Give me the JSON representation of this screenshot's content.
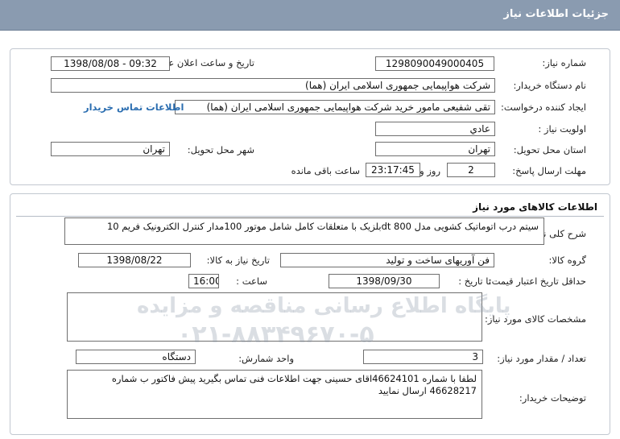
{
  "header": {
    "title": "جزئیات اطلاعات نیاز"
  },
  "info": {
    "need_number_label": "شماره نیاز:",
    "need_number": "1298090049000405",
    "announce_label": "تاریخ و ساعت اعلان عمومی:",
    "announce_value": "1398/08/08 - 09:32",
    "buyer_label": "نام دستگاه خریدار:",
    "buyer_value": "شرکت هواپیمایی جمهوری اسلامی ایران (هما)",
    "creator_label": "ایجاد کننده درخواست:",
    "creator_value": "تقی  شفیعی مامور خرید شرکت هواپیمایی جمهوری اسلامی ایران (هما)",
    "contact_link": "اطلاعات تماس خریدار",
    "priority_label": "اولویت نیاز :",
    "priority_value": "عادي",
    "province_label": "استان محل تحویل:",
    "province_value": "تهران",
    "city_label": "شهر محل تحویل:",
    "city_value": "تهران",
    "deadline_label": "مهلت ارسال پاسخ:",
    "deadline_days": "2",
    "days_word": "روز و",
    "deadline_time": "23:17:45",
    "remaining_word": "ساعت باقی مانده"
  },
  "goods": {
    "section_title": "اطلاعات کالاهای مورد نیاز",
    "summary_label": "شرح کلی نیاز:",
    "summary_value": "سیتم درب اتوماتیک کشویی مدل dt 800بلزیک با متعلقات کامل شامل موتور 100مدار کنترل الکترونیک  فریم 10",
    "group_label": "گروه کالا:",
    "group_value": "فن آوریهای ساخت و تولید",
    "need_date_label": "تاریخ نیاز به کالا:",
    "need_date_value": "1398/08/22",
    "validity_label": "حداقل تاریخ اعتبار قیمت:",
    "until_date_label": "تا تاریخ :",
    "until_date_value": "1398/09/30",
    "hour_label": "ساعت :",
    "hour_value": "16:00",
    "specs_label": "مشخصات کالای مورد نیاز:",
    "qty_label": "تعداد / مقدار مورد نیاز:",
    "qty_value": "3",
    "unit_label": "واحد شمارش:",
    "unit_value": "دستگاه",
    "desc_label": "توضیحات خریدار:",
    "desc_value": "لطفا با شماره 46624101اقای حسینی  جهت اطلاعات فنی تماس بگیرید پیش فاکتور ب شماره 46628217 ارسال نمایید"
  },
  "watermark": {
    "line1": "پایگاه اطلاع رسانی مناقصه و مزایده",
    "line2": "۰۲۱-۸۸۳۴۹۶۷۰-۵"
  }
}
